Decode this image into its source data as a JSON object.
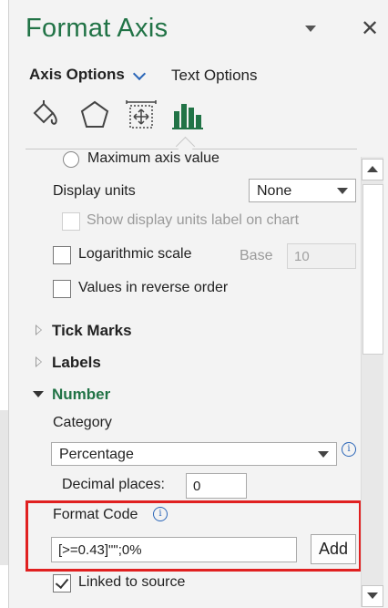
{
  "pane": {
    "title": "Format Axis",
    "close_glyph": "✕"
  },
  "tabs": {
    "axis_options": "Axis Options",
    "text_options": "Text Options"
  },
  "icons": [
    "fill-line-icon",
    "effects-icon",
    "size-properties-icon",
    "axis-options-icon"
  ],
  "axis_options": {
    "max_axis_value_label": "Maximum axis value",
    "display_units_label": "Display units",
    "display_units_value": "None",
    "show_display_units_label": "Show display units label on chart",
    "logarithmic_scale_label": "Logarithmic scale",
    "base_label": "Base",
    "base_value": "10",
    "values_reverse_label": "Values in reverse order"
  },
  "sections": {
    "tick_marks": "Tick Marks",
    "labels": "Labels",
    "number": "Number"
  },
  "number": {
    "category_label": "Category",
    "category_value": "Percentage",
    "decimal_places_label": "Decimal places:",
    "decimal_places_value": "0",
    "format_code_label": "Format Code",
    "format_code_value": "[>=0.43]\"\";0%",
    "add_button": "Add",
    "linked_to_source_label": "Linked to source",
    "linked_to_source_checked": true
  },
  "colors": {
    "accent_green": "#217346",
    "highlight_red": "#e02020",
    "link_blue": "#2b66b8"
  }
}
